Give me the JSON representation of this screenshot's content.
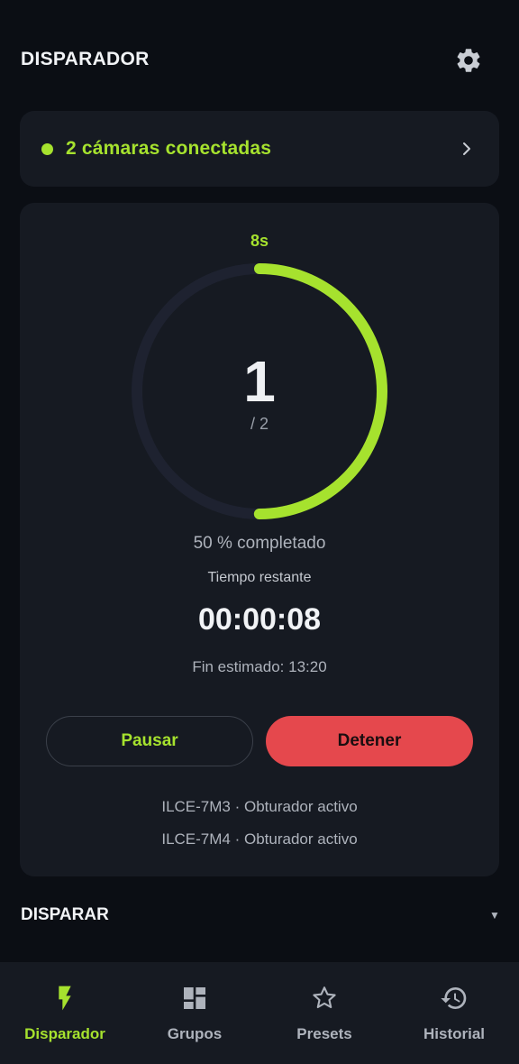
{
  "header": {
    "title": "DISPARADOR",
    "settings_icon": "gear-icon"
  },
  "connection": {
    "text": "2 cámaras conectadas",
    "status_color": "#a6e22e",
    "icon": "chevron-right-icon"
  },
  "timer": {
    "interval_label": "8s",
    "current_shot": "1",
    "total_shots": "/ 2",
    "progress_fraction": 0.5,
    "progress_text": "50 % completado",
    "remaining_label": "Tiempo restante",
    "remaining_time": "00:00:08",
    "eta_text": "Fin estimado: 13:20"
  },
  "actions": {
    "pause_label": "Pausar",
    "stop_label": "Detener",
    "stop_color": "#e5484d"
  },
  "cameras": [
    {
      "text": "ILCE-7M3 · Obturador activo"
    },
    {
      "text": "ILCE-7M4 · Obturador activo"
    }
  ],
  "section": {
    "title": "DISPARAR",
    "caret": "▼"
  },
  "nav": {
    "items": [
      {
        "label": "Disparador",
        "icon": "lightning-icon",
        "active": true
      },
      {
        "label": "Grupos",
        "icon": "dashboard-icon",
        "active": false
      },
      {
        "label": "Presets",
        "icon": "star-icon",
        "active": false
      },
      {
        "label": "Historial",
        "icon": "history-icon",
        "active": false
      }
    ]
  },
  "colors": {
    "accent": "#a6e22e",
    "danger": "#e5484d",
    "background": "#0b0e14",
    "card": "#161a22"
  }
}
